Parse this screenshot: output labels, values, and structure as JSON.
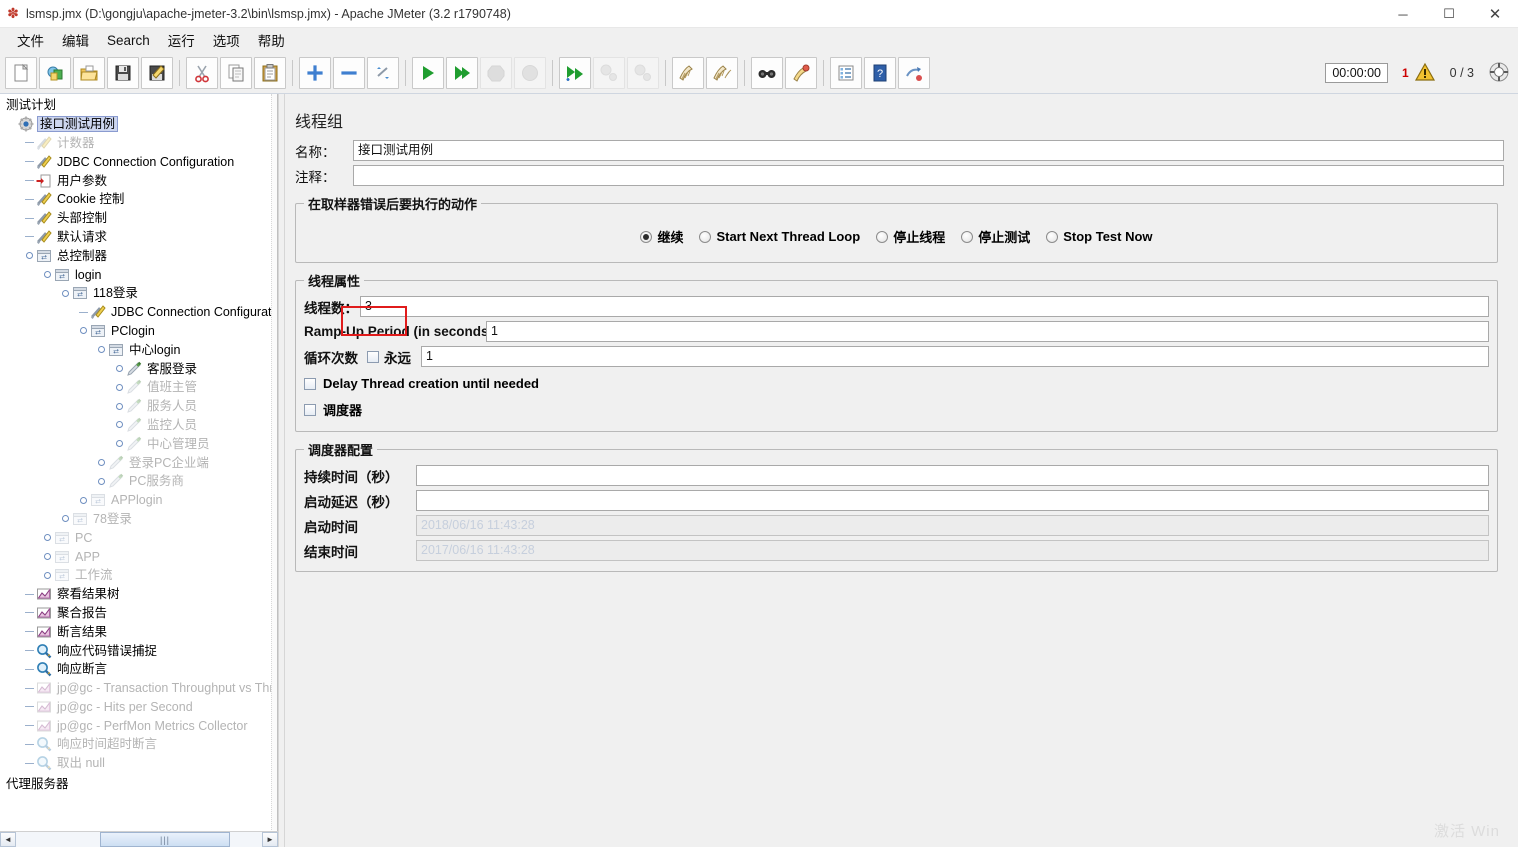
{
  "window": {
    "title": "lsmsp.jmx (D:\\gongju\\apache-jmeter-3.2\\bin\\lsmsp.jmx) - Apache JMeter (3.2 r1790748)",
    "app_icon": "jmeter-feather-icon",
    "minimize": "─",
    "maximize": "☐",
    "close": "✕"
  },
  "menu": {
    "items": [
      "文件",
      "编辑",
      "Search",
      "运行",
      "选项",
      "帮助"
    ]
  },
  "toolbar": {
    "buttons": [
      {
        "name": "new-icon",
        "group": 1,
        "disabled": false
      },
      {
        "name": "templates-icon",
        "group": 1,
        "disabled": false
      },
      {
        "name": "open-icon",
        "group": 1,
        "disabled": false
      },
      {
        "name": "save-icon",
        "group": 1,
        "disabled": false
      },
      {
        "name": "save-as-icon",
        "group": 1,
        "disabled": false
      },
      {
        "name": "cut-icon",
        "group": 2,
        "disabled": false
      },
      {
        "name": "copy-icon",
        "group": 2,
        "disabled": false
      },
      {
        "name": "paste-icon",
        "group": 2,
        "disabled": false
      },
      {
        "name": "expand-all-icon",
        "group": 3,
        "disabled": false
      },
      {
        "name": "collapse-all-icon",
        "group": 3,
        "disabled": false
      },
      {
        "name": "toggle-icon",
        "group": 3,
        "disabled": false
      },
      {
        "name": "start-icon",
        "group": 4,
        "disabled": false
      },
      {
        "name": "start-no-timers-icon",
        "group": 4,
        "disabled": false
      },
      {
        "name": "stop-icon",
        "group": 4,
        "disabled": true
      },
      {
        "name": "shutdown-icon",
        "group": 4,
        "disabled": true
      },
      {
        "name": "remote-start-all-icon",
        "group": 5,
        "disabled": false
      },
      {
        "name": "remote-stop-all-icon",
        "group": 5,
        "disabled": true
      },
      {
        "name": "remote-shutdown-all-icon",
        "group": 5,
        "disabled": true
      },
      {
        "name": "clear-icon",
        "group": 6,
        "disabled": false
      },
      {
        "name": "clear-all-icon",
        "group": 6,
        "disabled": false
      },
      {
        "name": "search-icon",
        "group": 7,
        "disabled": false
      },
      {
        "name": "search-reset-icon",
        "group": 7,
        "disabled": false
      },
      {
        "name": "function-helper-icon",
        "group": 8,
        "disabled": false
      },
      {
        "name": "help-icon",
        "group": 8,
        "disabled": false
      },
      {
        "name": "undo-redo-icon",
        "group": 8,
        "disabled": false
      }
    ],
    "timer": "00:00:00",
    "error_count": "1",
    "warning_icon": "warning-triangle-icon",
    "thread_count": "0 / 3",
    "gear_icon": "connection-status-icon"
  },
  "tree": {
    "root_label": "测试计划",
    "footer_label": "代理服务器",
    "nodes": [
      {
        "label": "接口测试用例",
        "indent": 0,
        "icon": "thread-group-icon",
        "selected": true,
        "disabled": false,
        "handle": "none"
      },
      {
        "label": "计数器",
        "indent": 1,
        "icon": "config-icon",
        "selected": false,
        "disabled": true,
        "handle": "leaf"
      },
      {
        "label": "JDBC Connection Configuration",
        "indent": 1,
        "icon": "config-icon",
        "selected": false,
        "disabled": false,
        "handle": "leaf"
      },
      {
        "label": "用户参数",
        "indent": 1,
        "icon": "user-params-icon",
        "selected": false,
        "disabled": false,
        "handle": "leaf"
      },
      {
        "label": "Cookie 控制",
        "indent": 1,
        "icon": "config-icon",
        "selected": false,
        "disabled": false,
        "handle": "leaf"
      },
      {
        "label": "头部控制",
        "indent": 1,
        "icon": "config-icon",
        "selected": false,
        "disabled": false,
        "handle": "leaf"
      },
      {
        "label": "默认请求",
        "indent": 1,
        "icon": "config-icon",
        "selected": false,
        "disabled": false,
        "handle": "leaf"
      },
      {
        "label": "总控制器",
        "indent": 1,
        "icon": "controller-icon",
        "selected": false,
        "disabled": false,
        "handle": "expanded"
      },
      {
        "label": "login",
        "indent": 2,
        "icon": "controller-icon",
        "selected": false,
        "disabled": false,
        "handle": "expanded"
      },
      {
        "label": "118登录",
        "indent": 3,
        "icon": "controller-icon",
        "selected": false,
        "disabled": false,
        "handle": "expanded"
      },
      {
        "label": "JDBC Connection Configuratio",
        "indent": 4,
        "icon": "config-icon",
        "selected": false,
        "disabled": false,
        "handle": "leaf"
      },
      {
        "label": "PClogin",
        "indent": 4,
        "icon": "controller-icon",
        "selected": false,
        "disabled": false,
        "handle": "expanded"
      },
      {
        "label": "中心login",
        "indent": 5,
        "icon": "controller-icon",
        "selected": false,
        "disabled": false,
        "handle": "expanded"
      },
      {
        "label": "客服登录",
        "indent": 6,
        "icon": "sampler-icon",
        "selected": false,
        "disabled": false,
        "handle": "knob"
      },
      {
        "label": "值班主管",
        "indent": 6,
        "icon": "sampler-icon",
        "selected": false,
        "disabled": true,
        "handle": "knob"
      },
      {
        "label": "服务人员",
        "indent": 6,
        "icon": "sampler-icon",
        "selected": false,
        "disabled": true,
        "handle": "knob"
      },
      {
        "label": "监控人员",
        "indent": 6,
        "icon": "sampler-icon",
        "selected": false,
        "disabled": true,
        "handle": "knob"
      },
      {
        "label": "中心管理员",
        "indent": 6,
        "icon": "sampler-icon",
        "selected": false,
        "disabled": true,
        "handle": "knob"
      },
      {
        "label": "登录PC企业端",
        "indent": 5,
        "icon": "sampler-icon",
        "selected": false,
        "disabled": true,
        "handle": "knob"
      },
      {
        "label": "PC服务商",
        "indent": 5,
        "icon": "sampler-icon",
        "selected": false,
        "disabled": true,
        "handle": "knob"
      },
      {
        "label": "APPlogin",
        "indent": 4,
        "icon": "controller-icon",
        "selected": false,
        "disabled": true,
        "handle": "knob"
      },
      {
        "label": "78登录",
        "indent": 3,
        "icon": "controller-icon",
        "selected": false,
        "disabled": true,
        "handle": "knob"
      },
      {
        "label": "PC",
        "indent": 2,
        "icon": "controller-icon",
        "selected": false,
        "disabled": true,
        "handle": "knob"
      },
      {
        "label": "APP",
        "indent": 2,
        "icon": "controller-icon",
        "selected": false,
        "disabled": true,
        "handle": "knob"
      },
      {
        "label": "工作流",
        "indent": 2,
        "icon": "controller-icon",
        "selected": false,
        "disabled": true,
        "handle": "knob"
      },
      {
        "label": "察看结果树",
        "indent": 1,
        "icon": "listener-icon",
        "selected": false,
        "disabled": false,
        "handle": "leaf"
      },
      {
        "label": "聚合报告",
        "indent": 1,
        "icon": "listener-icon",
        "selected": false,
        "disabled": false,
        "handle": "leaf"
      },
      {
        "label": "断言结果",
        "indent": 1,
        "icon": "listener-icon",
        "selected": false,
        "disabled": false,
        "handle": "leaf"
      },
      {
        "label": "响应代码错误捕捉",
        "indent": 1,
        "icon": "assertion-icon",
        "selected": false,
        "disabled": false,
        "handle": "leaf"
      },
      {
        "label": "响应断言",
        "indent": 1,
        "icon": "assertion-icon",
        "selected": false,
        "disabled": false,
        "handle": "leaf"
      },
      {
        "label": "jp@gc - Transaction Throughput vs Threa",
        "indent": 1,
        "icon": "listener-icon",
        "selected": false,
        "disabled": true,
        "handle": "leaf"
      },
      {
        "label": "jp@gc - Hits per Second",
        "indent": 1,
        "icon": "listener-icon",
        "selected": false,
        "disabled": true,
        "handle": "leaf"
      },
      {
        "label": "jp@gc - PerfMon Metrics Collector",
        "indent": 1,
        "icon": "listener-icon",
        "selected": false,
        "disabled": true,
        "handle": "leaf"
      },
      {
        "label": "响应时间超时断言",
        "indent": 1,
        "icon": "assertion-icon",
        "selected": false,
        "disabled": true,
        "handle": "leaf"
      },
      {
        "label": "取出 null",
        "indent": 1,
        "icon": "assertion-icon",
        "selected": false,
        "disabled": true,
        "handle": "leaf"
      }
    ],
    "scrollbar": {
      "left_arrow": "◄",
      "right_arrow": "►",
      "grip": "|||"
    }
  },
  "panel": {
    "title": "线程组",
    "name_label": "名称：",
    "name_value": "接口测试用例",
    "comment_label": "注释：",
    "comment_value": "",
    "error_action": {
      "legend": "在取样器错误后要执行的动作",
      "options": [
        {
          "label": "继续",
          "selected": true
        },
        {
          "label": "Start Next Thread Loop",
          "selected": false
        },
        {
          "label": "停止线程",
          "selected": false
        },
        {
          "label": "停止测试",
          "selected": false
        },
        {
          "label": "Stop Test Now",
          "selected": false
        }
      ]
    },
    "thread_props": {
      "legend": "线程属性",
      "threads_label": "线程数：",
      "threads_value": "3",
      "rampup_label": "Ramp-Up Period (in seconds):",
      "rampup_value": "1",
      "loop_label": "循环次数",
      "forever_label": "永远",
      "forever_checked": false,
      "loop_value": "1",
      "delay_label": "Delay Thread creation until needed",
      "delay_checked": false,
      "scheduler_label": "调度器",
      "scheduler_checked": false,
      "highlight_color": "#e01b1b"
    },
    "scheduler": {
      "legend": "调度器配置",
      "duration_label": "持续时间（秒）",
      "duration_value": "",
      "delay_label": "启动延迟（秒）",
      "delay_value": "",
      "start_label": "启动时间",
      "start_value": "2018/06/16 11:43:28",
      "end_label": "结束时间",
      "end_value": "2017/06/16 11:43:28"
    }
  },
  "watermark": "激活 Win"
}
